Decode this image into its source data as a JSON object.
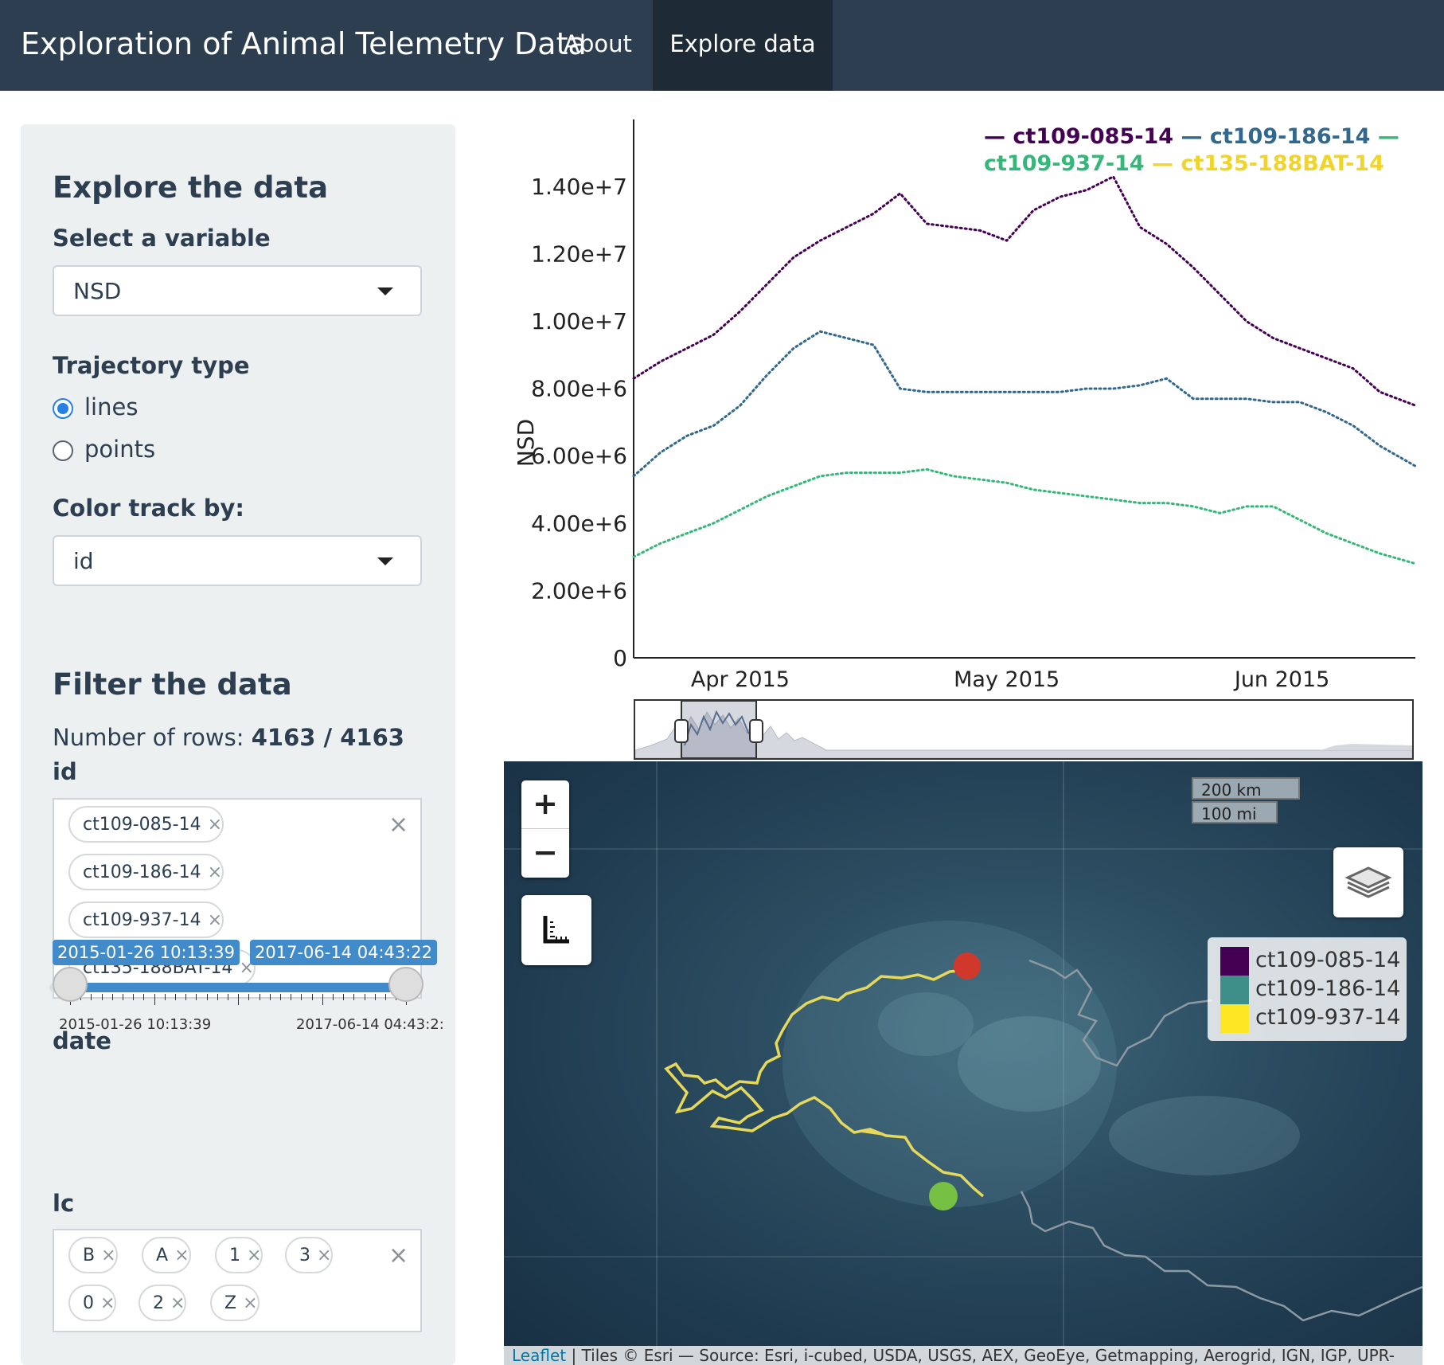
{
  "navbar": {
    "brand": "Exploration of Animal Telemetry Data",
    "tabs": [
      {
        "label": "About",
        "active": false
      },
      {
        "label": "Explore data",
        "active": true
      }
    ],
    "bg_color": "#2c3e50"
  },
  "sidebar": {
    "explore_heading": "Explore the data",
    "variable_label": "Select a variable",
    "variable_value": "NSD",
    "trajectory_label": "Trajectory type",
    "trajectory_options": [
      {
        "label": "lines",
        "checked": true
      },
      {
        "label": "points",
        "checked": false
      }
    ],
    "color_label": "Color track by:",
    "color_value": "id",
    "filter_heading": "Filter the data",
    "rows_prefix": "Number of rows: ",
    "rows_value": "4163 / 4163",
    "id_label": "id",
    "id_tags": [
      "ct109-085-14",
      "ct109-186-14",
      "ct109-937-14",
      "ct135-188BAT-14"
    ],
    "tag_remove_glyph": "×",
    "date_label": "date",
    "date_from": "2015-01-26 10:13:39",
    "date_to": "2017-06-14 04:43:22",
    "date_min_label": "2015-01-26 10:13:39",
    "date_max_label": "2017-06-14 04:43:2:",
    "lc_label": "lc",
    "lc_tags": [
      "B",
      "A",
      "1",
      "3",
      "0",
      "2",
      "Z"
    ],
    "clear_glyph": "×"
  },
  "chart_data": {
    "type": "line",
    "ylabel": "NSD",
    "xlabel": "",
    "x_ticks": [
      "Apr 2015",
      "May 2015",
      "Jun 2015"
    ],
    "y_ticks": [
      "0",
      "2.00e+6",
      "4.00e+6",
      "6.00e+6",
      "8.00e+6",
      "1.00e+7",
      "1.20e+7",
      "1.40e+7"
    ],
    "ylim": [
      0,
      16000000
    ],
    "x_range": [
      "2015-03-20",
      "2015-06-16"
    ],
    "legend_position": "top-right",
    "series": [
      {
        "name": "ct109-085-14",
        "color": "#440154",
        "x": [
          "2015-03-20",
          "2015-03-23",
          "2015-03-26",
          "2015-03-29",
          "2015-04-01",
          "2015-04-04",
          "2015-04-07",
          "2015-04-10",
          "2015-04-13",
          "2015-04-16",
          "2015-04-19",
          "2015-04-22",
          "2015-04-25",
          "2015-04-28",
          "2015-05-01",
          "2015-05-04",
          "2015-05-07",
          "2015-05-10",
          "2015-05-13",
          "2015-05-16",
          "2015-05-19",
          "2015-05-22",
          "2015-05-25",
          "2015-05-28",
          "2015-05-31",
          "2015-06-03",
          "2015-06-06",
          "2015-06-09",
          "2015-06-12",
          "2015-06-16"
        ],
        "y": [
          8300000,
          8800000,
          9200000,
          9600000,
          10300000,
          11100000,
          11900000,
          12400000,
          12800000,
          13200000,
          13800000,
          12900000,
          12800000,
          12700000,
          12400000,
          13300000,
          13700000,
          13900000,
          14300000,
          12800000,
          12300000,
          11600000,
          10800000,
          10000000,
          9500000,
          9200000,
          8900000,
          8600000,
          7900000,
          7500000
        ]
      },
      {
        "name": "ct109-186-14",
        "color": "#31688e",
        "x": [
          "2015-03-20",
          "2015-03-23",
          "2015-03-26",
          "2015-03-29",
          "2015-04-01",
          "2015-04-04",
          "2015-04-07",
          "2015-04-10",
          "2015-04-13",
          "2015-04-16",
          "2015-04-19",
          "2015-04-22",
          "2015-04-25",
          "2015-04-28",
          "2015-05-01",
          "2015-05-04",
          "2015-05-07",
          "2015-05-10",
          "2015-05-13",
          "2015-05-16",
          "2015-05-19",
          "2015-05-22",
          "2015-05-25",
          "2015-05-28",
          "2015-05-31",
          "2015-06-03",
          "2015-06-06",
          "2015-06-09",
          "2015-06-12",
          "2015-06-16"
        ],
        "y": [
          5400000,
          6100000,
          6600000,
          6900000,
          7500000,
          8400000,
          9200000,
          9700000,
          9500000,
          9300000,
          8000000,
          7900000,
          7900000,
          7900000,
          7900000,
          7900000,
          7900000,
          8000000,
          8000000,
          8100000,
          8300000,
          7700000,
          7700000,
          7700000,
          7600000,
          7600000,
          7300000,
          6900000,
          6300000,
          5700000
        ]
      },
      {
        "name": "ct109-937-14",
        "color": "#35b779",
        "x": [
          "2015-03-20",
          "2015-03-23",
          "2015-03-26",
          "2015-03-29",
          "2015-04-01",
          "2015-04-04",
          "2015-04-07",
          "2015-04-10",
          "2015-04-13",
          "2015-04-16",
          "2015-04-19",
          "2015-04-22",
          "2015-04-25",
          "2015-04-28",
          "2015-05-01",
          "2015-05-04",
          "2015-05-07",
          "2015-05-10",
          "2015-05-13",
          "2015-05-16",
          "2015-05-19",
          "2015-05-22",
          "2015-05-25",
          "2015-05-28",
          "2015-05-31",
          "2015-06-03",
          "2015-06-06",
          "2015-06-09",
          "2015-06-12",
          "2015-06-16"
        ],
        "y": [
          3000000,
          3400000,
          3700000,
          4000000,
          4400000,
          4800000,
          5100000,
          5400000,
          5500000,
          5500000,
          5500000,
          5600000,
          5400000,
          5300000,
          5200000,
          5000000,
          4900000,
          4800000,
          4700000,
          4600000,
          4600000,
          4500000,
          4300000,
          4500000,
          4500000,
          4100000,
          3700000,
          3400000,
          3100000,
          2800000
        ]
      },
      {
        "name": "ct135-188BAT-14",
        "color": "#fde725",
        "x": [],
        "y": []
      }
    ]
  },
  "map": {
    "zoom_in": "+",
    "zoom_out": "−",
    "scale_km": "200 km",
    "scale_mi": "100 mi",
    "legend": [
      {
        "label": "ct109-085-14",
        "color": "#440154"
      },
      {
        "label": "ct109-186-14",
        "color": "#3e8f8a"
      },
      {
        "label": "ct109-937-14",
        "color": "#fde725"
      }
    ],
    "attribution_link": "Leaflet",
    "attribution_text": " | Tiles © Esri — Source: Esri, i-cubed, USDA, USGS, AEX, GeoEye, Getmapping, Aerogrid, IGN, IGP, UPR-",
    "track_color": "#e6d85a",
    "start_color": "#76c043",
    "end_color": "#d0382b"
  }
}
